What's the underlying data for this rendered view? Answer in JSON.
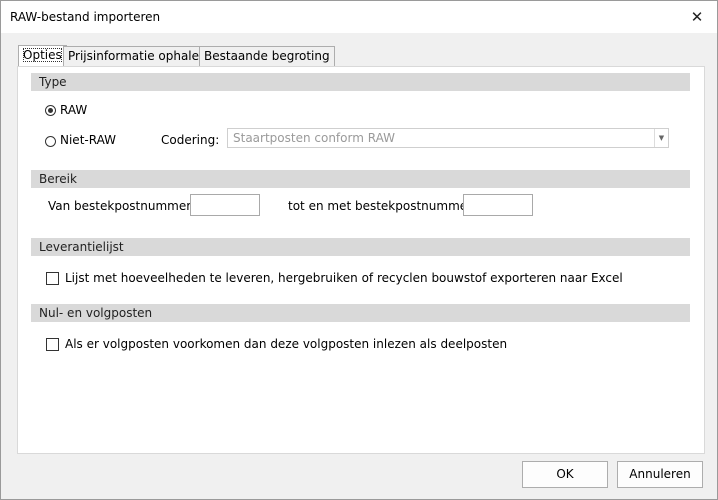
{
  "window": {
    "title": "RAW-bestand importeren",
    "close_icon": "close-icon"
  },
  "tabs": [
    {
      "label": "Opties",
      "active": true
    },
    {
      "label": "Prijsinformatie ophalen",
      "active": false
    },
    {
      "label": "Bestaande begroting",
      "active": false
    }
  ],
  "type_section": {
    "header": "Type",
    "raw_label": "RAW",
    "raw_selected": true,
    "nonraw_label": "Niet-RAW",
    "coding_label": "Codering:",
    "coding_value": "Staartposten conform RAW"
  },
  "range_section": {
    "header": "Bereik",
    "from_label": "Van bestekpostnummer",
    "from_value": "",
    "to_label": "tot en met bestekpostnummer",
    "to_value": ""
  },
  "supplier_section": {
    "header": "Leverantielijst",
    "checkbox_label": "Lijst met hoeveelheden te leveren, hergebruiken of recyclen bouwstof exporteren naar Excel",
    "checked": false
  },
  "followup_section": {
    "header": "Nul- en volgposten",
    "checkbox_label": "Als er volgposten voorkomen dan deze volgposten inlezen als deelposten",
    "checked": false
  },
  "buttons": {
    "ok": "OK",
    "cancel": "Annuleren"
  }
}
